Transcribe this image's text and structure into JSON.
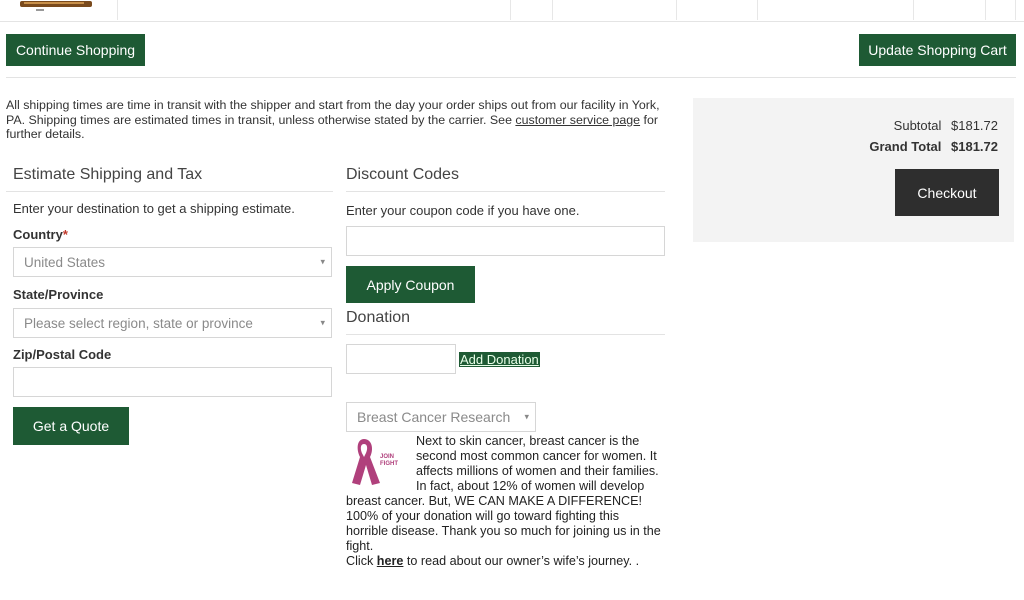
{
  "top": {
    "continue_label": "Continue Shopping",
    "update_label": "Update Shopping Cart"
  },
  "shipping_note": {
    "before_link": "All shipping times are time in transit with the shipper and start from the day your order ships out from our facility in York, PA. Shipping times are estimated times in transit, unless otherwise stated by the carrier. See ",
    "link": "customer service page",
    "after_link": " for further details."
  },
  "estimate": {
    "title": "Estimate Shipping and Tax",
    "intro": "Enter your destination to get a shipping estimate.",
    "country_label": "Country",
    "country_required": "*",
    "country_value": "United States",
    "state_label": "State/Province",
    "state_placeholder": "Please select region, state or province",
    "zip_label": "Zip/Postal Code",
    "zip_value": "",
    "quote_label": "Get a Quote"
  },
  "discount": {
    "title": "Discount Codes",
    "intro": "Enter your coupon code if you have one.",
    "coupon_value": "",
    "apply_label": "Apply Coupon"
  },
  "donation": {
    "title": "Donation",
    "amount_value": "",
    "add_label": "Add Donation",
    "cause_selected": "Breast Cancer Research",
    "ribbon_text": "JOIN FIGHT",
    "text_before_link": "Next to skin cancer, breast cancer is the second most common cancer for women. It affects millions of women and their families. In fact, about 12% of women will develop breast cancer. But, WE CAN MAKE A DIFFERENCE! 100% of your donation will go toward fighting this horrible disease. Thank you so much for joining us in the fight.",
    "click_prefix": "Click ",
    "link_text": "here",
    "text_after_link": " to read about our owner’s wife’s journey. ."
  },
  "summary": {
    "subtotal_label": "Subtotal",
    "subtotal_value": "$181.72",
    "grand_total_label": "Grand Total",
    "grand_total_value": "$181.72",
    "checkout_label": "Checkout"
  },
  "colors": {
    "primary_green": "#1e5a34",
    "checkout_dark": "#2e2e2e",
    "panel_gray": "#f3f3f3",
    "ribbon_pink": "#b0407c"
  },
  "icons": {
    "dropdown": "caret-down-icon",
    "ribbon": "pink-ribbon-icon"
  }
}
